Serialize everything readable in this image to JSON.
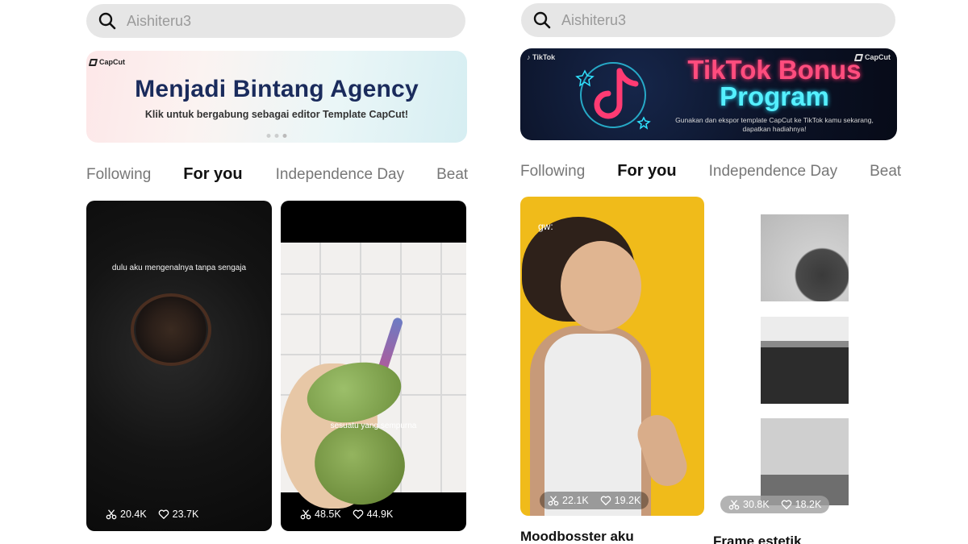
{
  "left": {
    "search": {
      "placeholder": "Aishiteru3"
    },
    "banner": {
      "brand": "CapCut",
      "title": "Menjadi Bintang Agency",
      "subtitle": "Klik untuk bergabung sebagai editor Template CapCut!"
    },
    "tabs": [
      "Following",
      "For you",
      "Independence Day",
      "Beat"
    ],
    "active_tab": "For you",
    "cards": [
      {
        "caption": "dulu aku mengenalnya tanpa sengaja",
        "uses": "20.4K",
        "likes": "23.7K"
      },
      {
        "caption": "sesuatu yang sempurna",
        "uses": "48.5K",
        "likes": "44.9K"
      }
    ]
  },
  "right": {
    "search": {
      "placeholder": "Aishiteru3"
    },
    "banner": {
      "brand_tiktok": "TikTok",
      "brand_capcut": "CapCut",
      "title_line1": "TikTok Bonus",
      "title_line2": "Program",
      "subtitle": "Gunakan dan ekspor template CapCut ke TikTok kamu sekarang, dapatkan hadiahnya!"
    },
    "tabs": [
      "Following",
      "For you",
      "Independence Day",
      "Beat"
    ],
    "active_tab": "For you",
    "cards": [
      {
        "overlay": "gw:",
        "uses": "22.1K",
        "likes": "19.2K",
        "title": "Moodbosster aku"
      },
      {
        "uses": "30.8K",
        "likes": "18.2K",
        "title": "Frame estetik"
      }
    ]
  },
  "colors": {
    "search_bg": "#e6e6e6",
    "accent_pink": "#ff4d7e",
    "accent_cyan": "#55f0ff",
    "card_yellow": "#f0bb1a"
  },
  "icons": [
    "search-icon",
    "scissors-icon",
    "heart-icon",
    "capcut-logo-icon",
    "tiktok-logo-icon"
  ]
}
